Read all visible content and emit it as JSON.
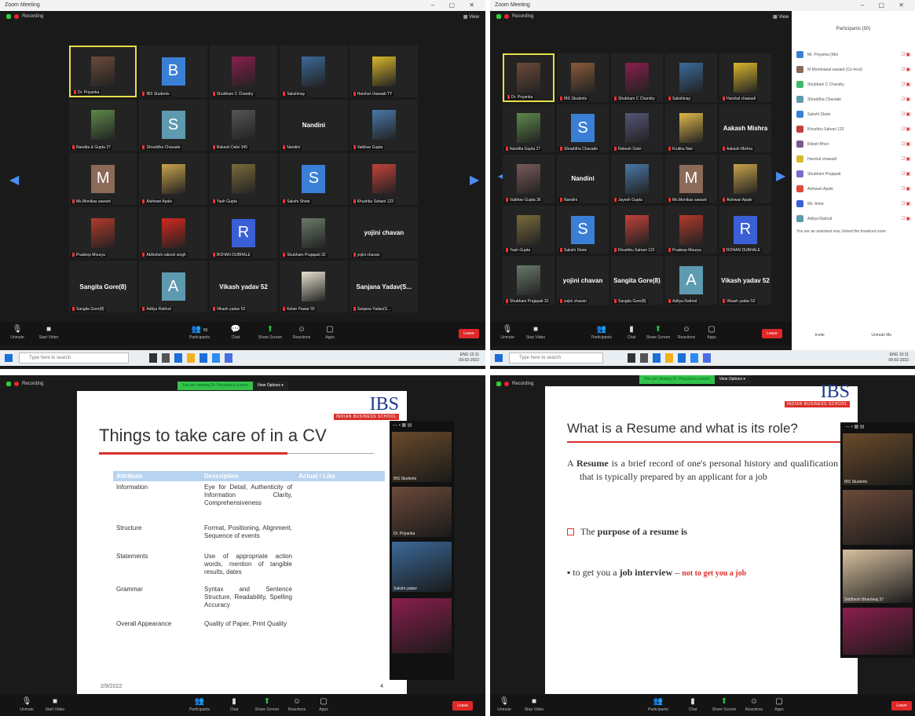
{
  "window_title": "Zoom Meeting",
  "recording_label": "Recording",
  "view_label": "View",
  "toolbar": {
    "unmute": "Unmute",
    "start_video": "Start Video",
    "stop_video": "Stop Video",
    "participants": "Participants",
    "participants_count": "50",
    "chat": "Chat",
    "share_screen": "Share Screen",
    "reactions": "Reactions",
    "apps": "Apps",
    "end": "Leave"
  },
  "taskbar": {
    "search_placeholder": "Type here to search",
    "tray_left": "ENG",
    "time": "10:11",
    "date": "09-02-2022"
  },
  "gallery1": [
    {
      "name": "Dr. Priyanka",
      "kind": "photo",
      "color": "#6b4a3a",
      "self": true
    },
    {
      "name": "IBS Students",
      "kind": "avatar",
      "letter": "B",
      "color": "#3a7fd6"
    },
    {
      "name": "Shubham C Chandry",
      "kind": "photo",
      "color": "#8a1e4c"
    },
    {
      "name": "Sakshinay",
      "kind": "photo",
      "color": "#3b6a9a"
    },
    {
      "name": "Harshal chawadi TY",
      "kind": "photo",
      "color": "#d9b82b"
    },
    {
      "name": "Nandita & Gupta 27",
      "kind": "photo",
      "color": "#5d8a4a"
    },
    {
      "name": "Shraddha Chavade",
      "kind": "avatar",
      "letter": "S",
      "color": "#5e9ab0"
    },
    {
      "name": "Rakesh Dalvi 345",
      "kind": "photo",
      "color": "#555"
    },
    {
      "name": "Nandini",
      "kind": "text",
      "text": "Nandini"
    },
    {
      "name": "Vaibhav Gupta",
      "kind": "photo",
      "color": "#4a78a8"
    },
    {
      "name": "Ms.Monikas sawant",
      "kind": "avatar",
      "letter": "M",
      "color": "#8b6a58"
    },
    {
      "name": "Aishwari Apale",
      "kind": "photo",
      "color": "#c9a44b"
    },
    {
      "name": "Yash Gupta",
      "kind": "photo",
      "color": "#7a6b3a"
    },
    {
      "name": "Sakshi Shete",
      "kind": "avatar",
      "letter": "S",
      "color": "#3a7fd6"
    },
    {
      "name": "Khushbu Sahani 123",
      "kind": "photo",
      "color": "#c4413a"
    },
    {
      "name": "Pradeep Mourya",
      "kind": "photo",
      "color": "#b33a2a"
    },
    {
      "name": "Abhishek rakesh singh",
      "kind": "photo",
      "color": "#d4281f"
    },
    {
      "name": "ROHAN DUBHALE",
      "kind": "avatar",
      "letter": "R",
      "color": "#3a5fd6"
    },
    {
      "name": "Shubham Prajapati 32",
      "kind": "photo",
      "color": "#6a7a6a"
    },
    {
      "name": "yojini chavan",
      "kind": "text",
      "text": "yojini chavan"
    },
    {
      "name": "Sangita Gore(8)",
      "kind": "text",
      "text": "Sangita Gore(8)"
    },
    {
      "name": "Aditya Rathod",
      "kind": "avatar",
      "letter": "A",
      "color": "#5e9ab0"
    },
    {
      "name": "Vikash yadav 52",
      "kind": "text",
      "text": "Vikash yadav 52"
    },
    {
      "name": "Ketan Pawar 55",
      "kind": "photo",
      "color": "#e8e2d0"
    },
    {
      "name": "Sanjana Yadav(S...",
      "kind": "text",
      "text": "Sanjana Yadav(S..."
    }
  ],
  "gallery2": [
    {
      "name": "Dr. Priyanka",
      "kind": "photo",
      "color": "#6b4a3a",
      "self": true
    },
    {
      "name": "IBS Students",
      "kind": "photo",
      "color": "#8a5a3a"
    },
    {
      "name": "Shubham C Chandry",
      "kind": "photo",
      "color": "#8a1e4c"
    },
    {
      "name": "Sakshinay",
      "kind": "photo",
      "color": "#3b6a9a"
    },
    {
      "name": "Harshal chawadi",
      "kind": "photo",
      "color": "#d9b82b"
    },
    {
      "name": "Nandita Gupta 27",
      "kind": "photo",
      "color": "#5d8a4a"
    },
    {
      "name": "Shraddha Chavade",
      "kind": "avatar",
      "letter": "S",
      "color": "#3a7fd6"
    },
    {
      "name": "Rakesh Dalvi",
      "kind": "photo",
      "color": "#557"
    },
    {
      "name": "Krutika Nair",
      "kind": "photo",
      "color": "#e0b84a"
    },
    {
      "name": "Aakash Mishra",
      "kind": "text",
      "text": "Aakash Mishra"
    },
    {
      "name": "Vaibhav Gupta 36",
      "kind": "photo",
      "color": "#7a5a5a"
    },
    {
      "name": "Nandini",
      "kind": "text",
      "text": "Nandini"
    },
    {
      "name": "Jayesh Gupta",
      "kind": "photo",
      "color": "#4a78a8"
    },
    {
      "name": "Ms.Monikas sawant",
      "kind": "avatar",
      "letter": "M",
      "color": "#8b6a58"
    },
    {
      "name": "Aishwari Apale",
      "kind": "photo",
      "color": "#c9a44b"
    },
    {
      "name": "Yash Gupta",
      "kind": "photo",
      "color": "#7a6b3a"
    },
    {
      "name": "Sakshi Shete",
      "kind": "avatar",
      "letter": "S",
      "color": "#3a7fd6"
    },
    {
      "name": "Khushbu Sahani 123",
      "kind": "photo",
      "color": "#c4413a"
    },
    {
      "name": "Pradeep Mourya",
      "kind": "photo",
      "color": "#b33a2a"
    },
    {
      "name": "ROHAN DUBHALE",
      "kind": "avatar",
      "letter": "R",
      "color": "#3a5fd6"
    },
    {
      "name": "Shubham Prajapati 32",
      "kind": "photo",
      "color": "#6a7a6a"
    },
    {
      "name": "yojini chavan",
      "kind": "text",
      "text": "yojini chavan"
    },
    {
      "name": "Sangita Gore(8)",
      "kind": "text",
      "text": "Sangita Gore(8)"
    },
    {
      "name": "Aditya Rathod",
      "kind": "avatar",
      "letter": "A",
      "color": "#5e9ab0"
    },
    {
      "name": "Vikash yadav 52",
      "kind": "text",
      "text": "Vikash yadav 52"
    }
  ],
  "participants_panel": {
    "title": "Participants (50)",
    "items": [
      {
        "name": "Mr. Priyanka (Me)",
        "color": "#3a7fd6"
      },
      {
        "name": "M Mondrawat sawant (Co-host)",
        "color": "#8b6a58"
      },
      {
        "name": "Shubham C Chandry",
        "color": "#3fb86a"
      },
      {
        "name": "Shraddha Chavade",
        "color": "#5e9ab0"
      },
      {
        "name": "Sakshi Shete",
        "color": "#3a7fd6"
      },
      {
        "name": "Khushbu Sahani 123",
        "color": "#c4413a"
      },
      {
        "name": "Ritesh Bhoir",
        "color": "#7a5a8a"
      },
      {
        "name": "Harshal chawadi",
        "color": "#d9b82b"
      },
      {
        "name": "Shubham Prajapati",
        "color": "#7a6bd0"
      },
      {
        "name": "Aishwari Apale",
        "color": "#e04a3a"
      },
      {
        "name": "Ms. Anita",
        "color": "#3a5fd6"
      },
      {
        "name": "Aditya Rathod",
        "color": "#5e9ab0"
      }
    ],
    "note": "You are an assistant now Joined the breakout room",
    "buttons": [
      "Invite",
      "Unmute Me"
    ]
  },
  "share_bar": {
    "status": "You are viewing Dr. Priyanka's screen",
    "options": "View Options"
  },
  "slide1": {
    "brand": "IBS",
    "brand_sub": "INDIAN BUSINESS SCHOOL",
    "title": "Things to take care of in a CV",
    "headers": [
      "Attribute",
      "Description",
      "Actual / Like"
    ],
    "rows": [
      [
        "Information",
        "Eye for Detail, Authenticity of Information Clarity, Comprehensiveness"
      ],
      [
        "Structure",
        "Format, Positioning, Alignment, Sequence of events"
      ],
      [
        "Statements",
        "Use of appropriate action words, mention of tangible results, dates"
      ],
      [
        "Grammar",
        "Syntax and Sentence Structure, Readability, Spelling Accuracy"
      ],
      [
        "Overall Appearance",
        "Quality of Paper, Print Quality"
      ]
    ],
    "footer_date": "2/9/2022",
    "page": "4"
  },
  "slide2": {
    "brand": "IBS",
    "brand_sub": "INDIAN BUSINESS SCHOOL",
    "title": "What is a Resume and what is its role?",
    "p1_prefix": "A",
    "p1_bold": "Resume",
    "p1_rest": "is a brief record of one's personal history and qualification that is typically prepared by an applicant for a job",
    "p2_plain": "The",
    "p2_bold": "purpose of a resume is",
    "p3_plain": "to get you a",
    "p3_bold": "job interview",
    "p3_red": "not to get you a job"
  },
  "strip1": [
    {
      "name": "IBS Students",
      "color": "#6a4a2a"
    },
    {
      "name": "Dr. Priyanka",
      "color": "#6b4a3a"
    },
    {
      "name": "Sakshi yadav",
      "color": "#3b6a9a"
    },
    {
      "name": "",
      "color": "#8a1e4c"
    }
  ],
  "strip2": [
    {
      "name": "IBS Students",
      "color": "#6a4a2a"
    },
    {
      "name": "",
      "color": "#6b4a3a"
    },
    {
      "name": "Siddhesh Bhardwaj 37",
      "color": "#d8c0a0"
    },
    {
      "name": "",
      "color": "#8a1e4c"
    }
  ]
}
